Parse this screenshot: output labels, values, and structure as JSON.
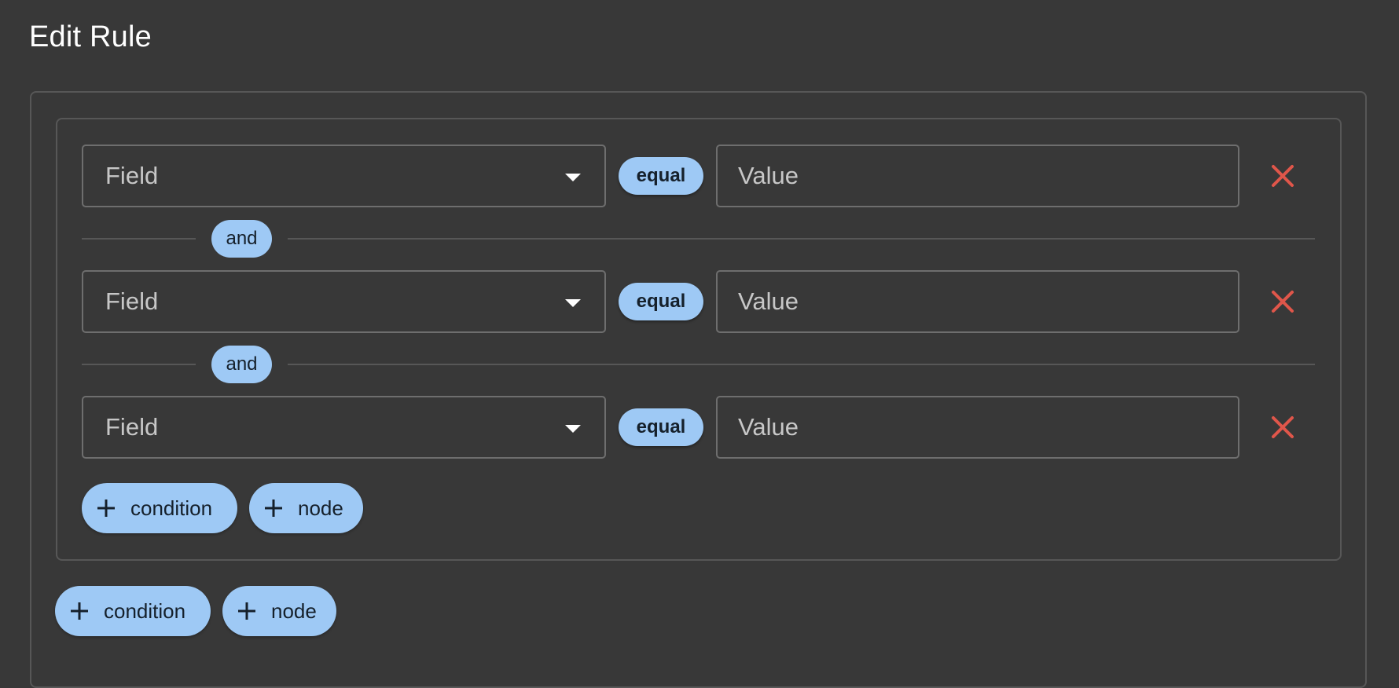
{
  "page": {
    "title": "Edit Rule"
  },
  "conditions": [
    {
      "field_placeholder": "Field",
      "operator": "equal",
      "value_placeholder": "Value"
    },
    {
      "field_placeholder": "Field",
      "operator": "equal",
      "value_placeholder": "Value"
    },
    {
      "field_placeholder": "Field",
      "operator": "equal",
      "value_placeholder": "Value"
    }
  ],
  "conjunctions": [
    "and",
    "and"
  ],
  "inner_group": {
    "add_condition_label": "condition",
    "add_node_label": "node"
  },
  "outer_group": {
    "add_condition_label": "condition",
    "add_node_label": "node"
  },
  "icons": {
    "field_dropdown": "chevron-down-icon",
    "remove": "close-icon",
    "add": "plus-icon"
  },
  "colors": {
    "background": "#383838",
    "chip": "#9ec9f5",
    "remove": "#e0564a",
    "border": "#6e6e6e"
  }
}
